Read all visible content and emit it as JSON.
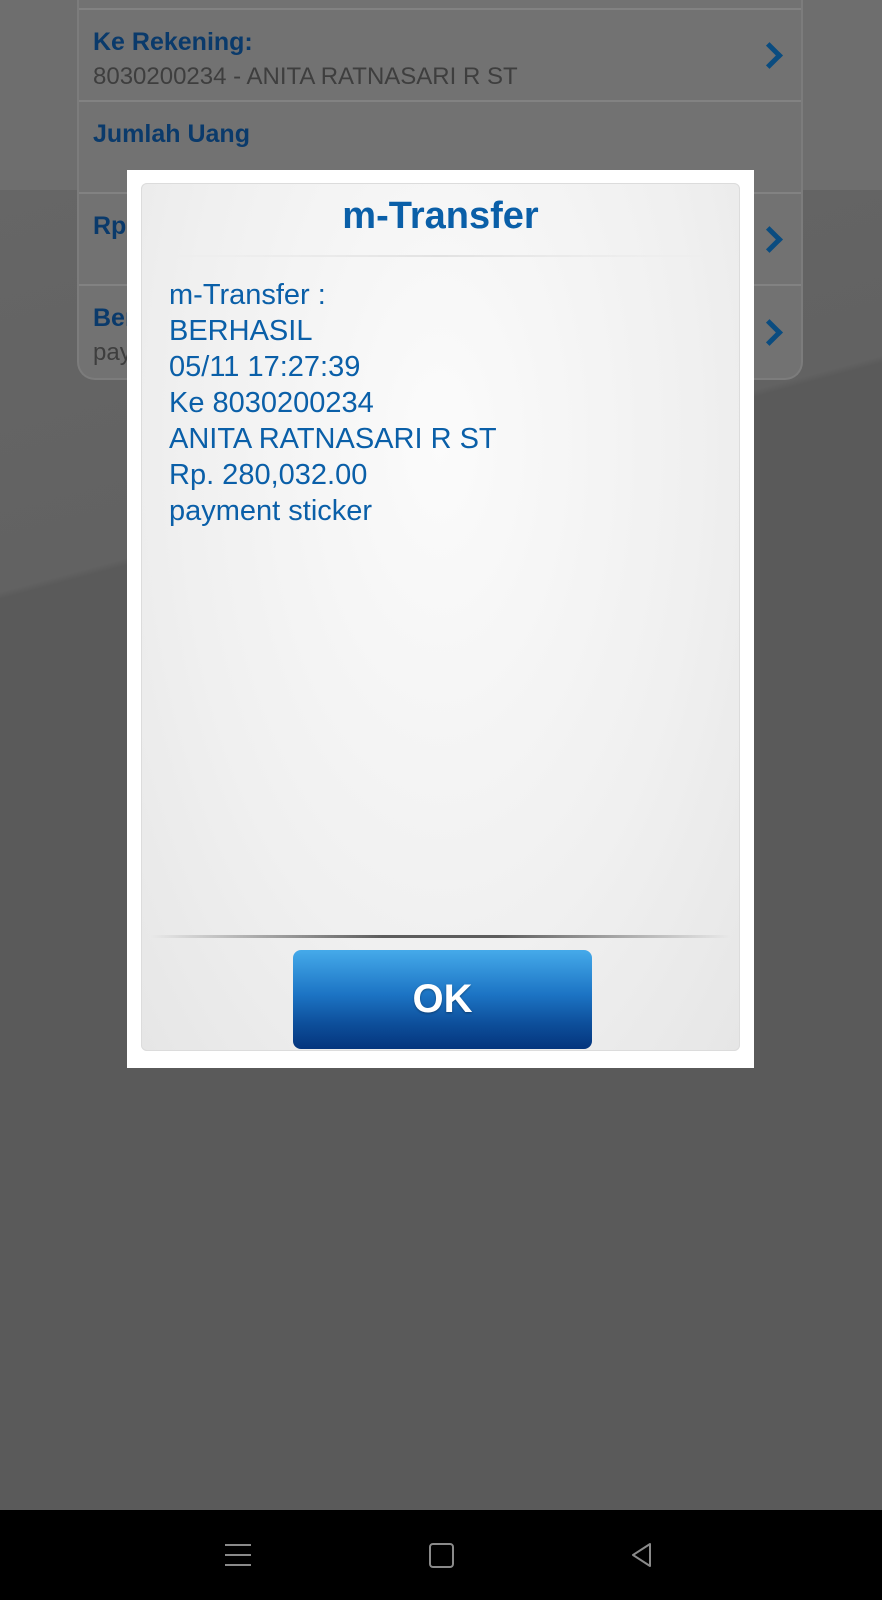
{
  "form": {
    "rows": [
      {
        "label": "Ke Rekening:",
        "value": "8030200234 - ANITA RATNASARI R ST"
      },
      {
        "label": "Jumlah Uang",
        "value": ""
      },
      {
        "label": "Rp",
        "value": ""
      },
      {
        "label": "Ber",
        "value": "pay"
      }
    ]
  },
  "dialog": {
    "title": "m-Transfer",
    "message_lines": [
      "m-Transfer :",
      "BERHASIL",
      "05/11 17:27:39",
      "Ke 8030200234",
      "ANITA RATNASARI R ST",
      "Rp. 280,032.00",
      "payment sticker"
    ],
    "ok_label": "OK"
  },
  "colors": {
    "accent": "#0a5fa8",
    "button_top": "#45aaea",
    "button_bottom": "#04357d",
    "overlay": "#5a5a5a",
    "navbar": "#000000"
  },
  "navbar": {
    "icons": [
      "menu-icon",
      "home-icon",
      "back-icon"
    ]
  }
}
